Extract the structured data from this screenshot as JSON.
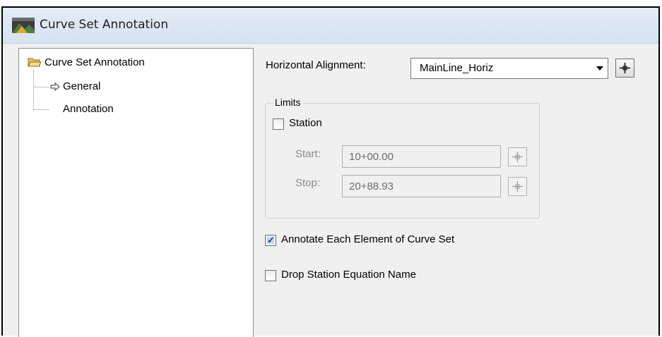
{
  "window": {
    "title": "Curve Set Annotation"
  },
  "tree": {
    "root": "Curve Set Annotation",
    "items": [
      {
        "label": "General",
        "selected": true
      },
      {
        "label": "Annotation",
        "selected": false
      }
    ]
  },
  "general": {
    "horizontal_alignment_label": "Horizontal Alignment:",
    "horizontal_alignment_value": "MainLine_Horiz",
    "limits": {
      "group_label": "Limits",
      "station_label": "Station",
      "station_checked": false,
      "start_label": "Start:",
      "start_value": "10+00.00",
      "stop_label": "Stop:",
      "stop_value": "20+88.93"
    },
    "annotate_each_label": "Annotate Each Element of Curve Set",
    "annotate_each_checked": true,
    "drop_station_label": "Drop Station Equation Name",
    "drop_station_checked": false
  },
  "colors": {
    "titlebar": "#dde7f3",
    "disabled_text": "#8a8a8a",
    "check_fill": "#c3d7f3"
  }
}
